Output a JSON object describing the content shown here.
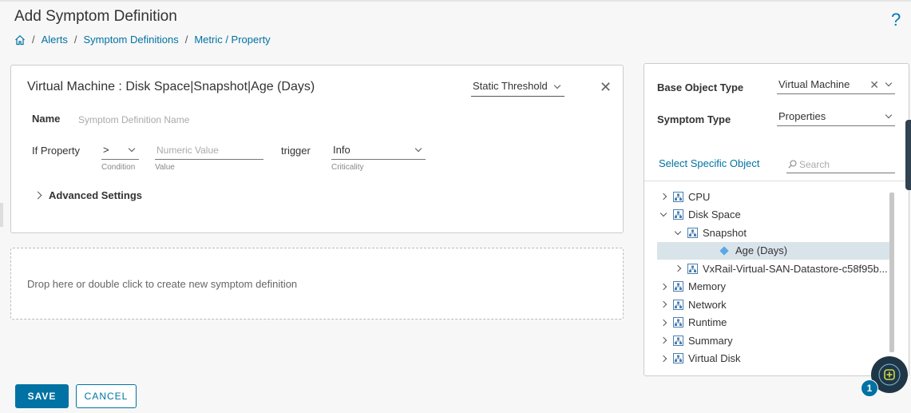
{
  "page": {
    "title": "Add Symptom Definition",
    "help_icon": "question-mark-icon",
    "help_symbol": "?"
  },
  "breadcrumb": {
    "home_icon": "home-icon",
    "items": [
      "Alerts",
      "Symptom Definitions",
      "Metric / Property"
    ],
    "separator": "/"
  },
  "definition": {
    "title": "Virtual Machine : Disk Space|Snapshot|Age (Days)",
    "threshold_type": "Static Threshold",
    "close_symbol": "✕",
    "name_label": "Name",
    "name_placeholder": "Symptom Definition Name",
    "if_property_label": "If Property",
    "condition_value": ">",
    "condition_sublabel": "Condition",
    "value_placeholder": "Numeric Value",
    "value_sublabel": "Value",
    "trigger_label": "trigger",
    "criticality_value": "Info",
    "criticality_sublabel": "Criticality",
    "advanced_label": "Advanced Settings"
  },
  "drop_zone": {
    "text": "Drop here or double click to create new symptom definition"
  },
  "side_panel": {
    "base_object_label": "Base Object Type",
    "base_object_value": "Virtual Machine",
    "clear_symbol": "✕",
    "symptom_type_label": "Symptom Type",
    "symptom_type_value": "Properties",
    "select_object_link": "Select Specific Object",
    "search_placeholder": "Search",
    "tree": [
      {
        "label": "CPU",
        "level": 0,
        "state": "collapsed",
        "icon": "property-group-icon"
      },
      {
        "label": "Disk Space",
        "level": 0,
        "state": "expanded",
        "icon": "property-group-icon"
      },
      {
        "label": "Snapshot",
        "level": 1,
        "state": "expanded",
        "icon": "property-group-icon"
      },
      {
        "label": "Age (Days)",
        "level": 2,
        "state": "leaf",
        "icon": "property-diamond-icon",
        "selected": true
      },
      {
        "label": "VxRail-Virtual-SAN-Datastore-c58f95b...",
        "level": 1,
        "state": "collapsed",
        "icon": "property-group-icon"
      },
      {
        "label": "Memory",
        "level": 0,
        "state": "collapsed",
        "icon": "property-group-icon"
      },
      {
        "label": "Network",
        "level": 0,
        "state": "collapsed",
        "icon": "property-group-icon"
      },
      {
        "label": "Runtime",
        "level": 0,
        "state": "collapsed",
        "icon": "property-group-icon"
      },
      {
        "label": "Summary",
        "level": 0,
        "state": "collapsed",
        "icon": "property-group-icon"
      },
      {
        "label": "Virtual Disk",
        "level": 0,
        "state": "collapsed",
        "icon": "property-group-icon"
      }
    ]
  },
  "footer": {
    "save_label": "SAVE",
    "cancel_label": "CANCEL"
  },
  "fab": {
    "icon": "quick-action-icon",
    "badge_count": "1"
  },
  "colors": {
    "accent": "#0072a3",
    "selected_row": "#d9e4ea",
    "fab_bg": "#1f3646"
  }
}
